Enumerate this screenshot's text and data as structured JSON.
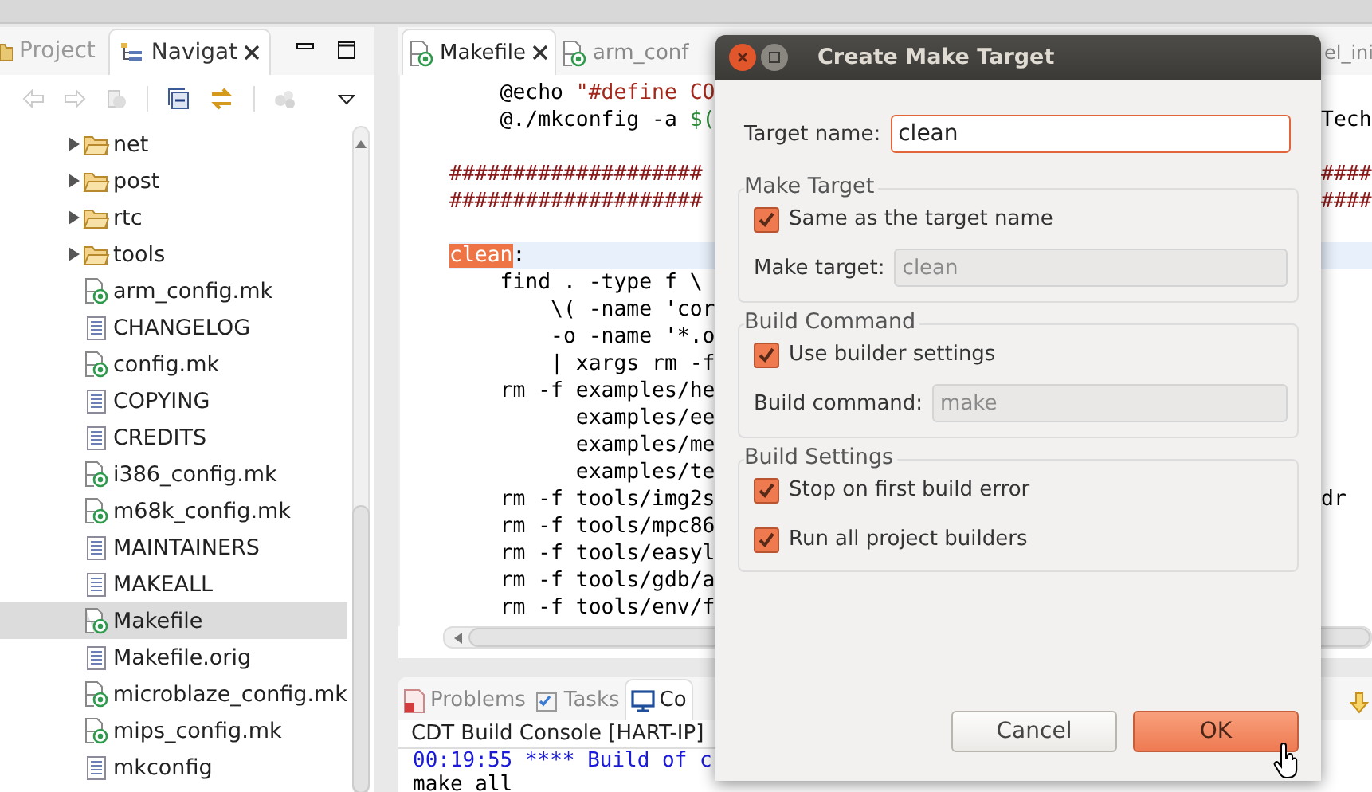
{
  "navigator": {
    "tabs": [
      {
        "label": "Project",
        "kind": "project",
        "selected": false,
        "closable": false
      },
      {
        "label": "Navigat",
        "kind": "navigator",
        "selected": true,
        "closable": true
      }
    ],
    "items": [
      {
        "name": "net",
        "kind": "folder",
        "expanded": false,
        "selected": false
      },
      {
        "name": "post",
        "kind": "folder",
        "expanded": false,
        "selected": false
      },
      {
        "name": "rtc",
        "kind": "folder",
        "expanded": false,
        "selected": false
      },
      {
        "name": "tools",
        "kind": "folder",
        "expanded": false,
        "selected": false
      },
      {
        "name": "arm_config.mk",
        "kind": "makefile",
        "selected": false
      },
      {
        "name": "CHANGELOG",
        "kind": "text",
        "selected": false
      },
      {
        "name": "config.mk",
        "kind": "makefile",
        "selected": false
      },
      {
        "name": "COPYING",
        "kind": "text",
        "selected": false
      },
      {
        "name": "CREDITS",
        "kind": "text",
        "selected": false
      },
      {
        "name": "i386_config.mk",
        "kind": "makefile",
        "selected": false
      },
      {
        "name": "m68k_config.mk",
        "kind": "makefile",
        "selected": false
      },
      {
        "name": "MAINTAINERS",
        "kind": "text",
        "selected": false
      },
      {
        "name": "MAKEALL",
        "kind": "text",
        "selected": false
      },
      {
        "name": "Makefile",
        "kind": "makefile",
        "selected": true
      },
      {
        "name": "Makefile.orig",
        "kind": "text",
        "selected": false
      },
      {
        "name": "microblaze_config.mk",
        "kind": "makefile",
        "selected": false
      },
      {
        "name": "mips_config.mk",
        "kind": "makefile",
        "selected": false
      },
      {
        "name": "mkconfig",
        "kind": "text",
        "selected": false
      }
    ]
  },
  "editor": {
    "tabs": [
      {
        "label": "Makefile",
        "selected": true,
        "closable": true
      },
      {
        "label": "arm_conf",
        "selected": false,
        "closable": false
      },
      {
        "label": "el_ini",
        "selected": false,
        "closable": false
      }
    ],
    "lines": [
      {
        "segments": [
          {
            "text": "    @echo ",
            "kind": "plain"
          },
          {
            "text": "\"#define CO",
            "kind": "string"
          }
        ],
        "current": false
      },
      {
        "segments": [
          {
            "text": "    @./mkconfig -a ",
            "kind": "plain"
          },
          {
            "text": "$(",
            "kind": "variable"
          }
        ],
        "right": "Tech",
        "current": false
      },
      {
        "current": false
      },
      {
        "segments": [
          {
            "text": "####################",
            "kind": "comment"
          }
        ],
        "right": "####",
        "current": false
      },
      {
        "segments": [
          {
            "text": "####################",
            "kind": "comment"
          }
        ],
        "right": "####",
        "current": false
      },
      {
        "current": false
      },
      {
        "segments": [
          {
            "text": "clean",
            "kind": "target"
          },
          {
            "text": ":",
            "kind": "plain"
          }
        ],
        "current": true
      },
      {
        "segments": [
          {
            "text": "    find . -type f \\",
            "kind": "plain"
          }
        ],
        "current": false
      },
      {
        "segments": [
          {
            "text": "        \\( -name 'cor",
            "kind": "plain"
          }
        ],
        "current": false
      },
      {
        "segments": [
          {
            "text": "        -o -name '*.o",
            "kind": "plain"
          }
        ],
        "current": false
      },
      {
        "segments": [
          {
            "text": "        | xargs rm -f",
            "kind": "plain"
          }
        ],
        "current": false
      },
      {
        "segments": [
          {
            "text": "    rm -f examples/he",
            "kind": "plain"
          }
        ],
        "current": false
      },
      {
        "segments": [
          {
            "text": "          examples/ee",
            "kind": "plain"
          }
        ],
        "current": false
      },
      {
        "segments": [
          {
            "text": "          examples/me",
            "kind": "plain"
          }
        ],
        "current": false
      },
      {
        "segments": [
          {
            "text": "          examples/te",
            "kind": "plain"
          }
        ],
        "current": false
      },
      {
        "segments": [
          {
            "text": "    rm -f tools/img2s",
            "kind": "plain"
          }
        ],
        "right": "dr",
        "current": false
      },
      {
        "segments": [
          {
            "text": "    rm -f tools/mpc86",
            "kind": "plain"
          }
        ],
        "current": false
      },
      {
        "segments": [
          {
            "text": "    rm -f tools/easyl",
            "kind": "plain"
          }
        ],
        "current": false
      },
      {
        "segments": [
          {
            "text": "    rm -f tools/gdb/a",
            "kind": "plain"
          }
        ],
        "current": false
      },
      {
        "segments": [
          {
            "text": "    rm -f tools/env/f",
            "kind": "plain"
          }
        ],
        "current": false
      }
    ]
  },
  "bottom_panel": {
    "tabs": [
      {
        "label": "Problems",
        "kind": "problems",
        "selected": false
      },
      {
        "label": "Tasks",
        "kind": "tasks",
        "selected": false
      },
      {
        "label": "Co",
        "kind": "console",
        "selected": true
      }
    ],
    "console_title": "CDT Build Console [HART-IP]",
    "console_lines": [
      {
        "text": "00:19:55 **** Build of c",
        "kind": "info"
      },
      {
        "text": "make all",
        "kind": "output"
      }
    ]
  },
  "dialog": {
    "title": "Create Make Target",
    "target_name": {
      "label": "Target name:",
      "value": "clean",
      "focused": true
    },
    "groups": [
      {
        "title": "Make Target",
        "rows": [
          {
            "kind": "checkbox",
            "label": "Same as the target name",
            "checked": true
          },
          {
            "kind": "field",
            "label": "Make target:",
            "value": "clean",
            "disabled": true
          }
        ]
      },
      {
        "title": "Build Command",
        "rows": [
          {
            "kind": "checkbox",
            "label": "Use builder settings",
            "checked": true
          },
          {
            "kind": "field",
            "label": "Build command:",
            "value": "make",
            "disabled": true
          }
        ]
      },
      {
        "title": "Build Settings",
        "rows": [
          {
            "kind": "checkbox",
            "label": "Stop on first build error",
            "checked": true
          },
          {
            "kind": "checkbox",
            "label": "Run all project builders",
            "checked": true
          }
        ]
      }
    ],
    "buttons": [
      {
        "label": "Cancel",
        "default": false
      },
      {
        "label": "OK",
        "default": true
      }
    ]
  }
}
